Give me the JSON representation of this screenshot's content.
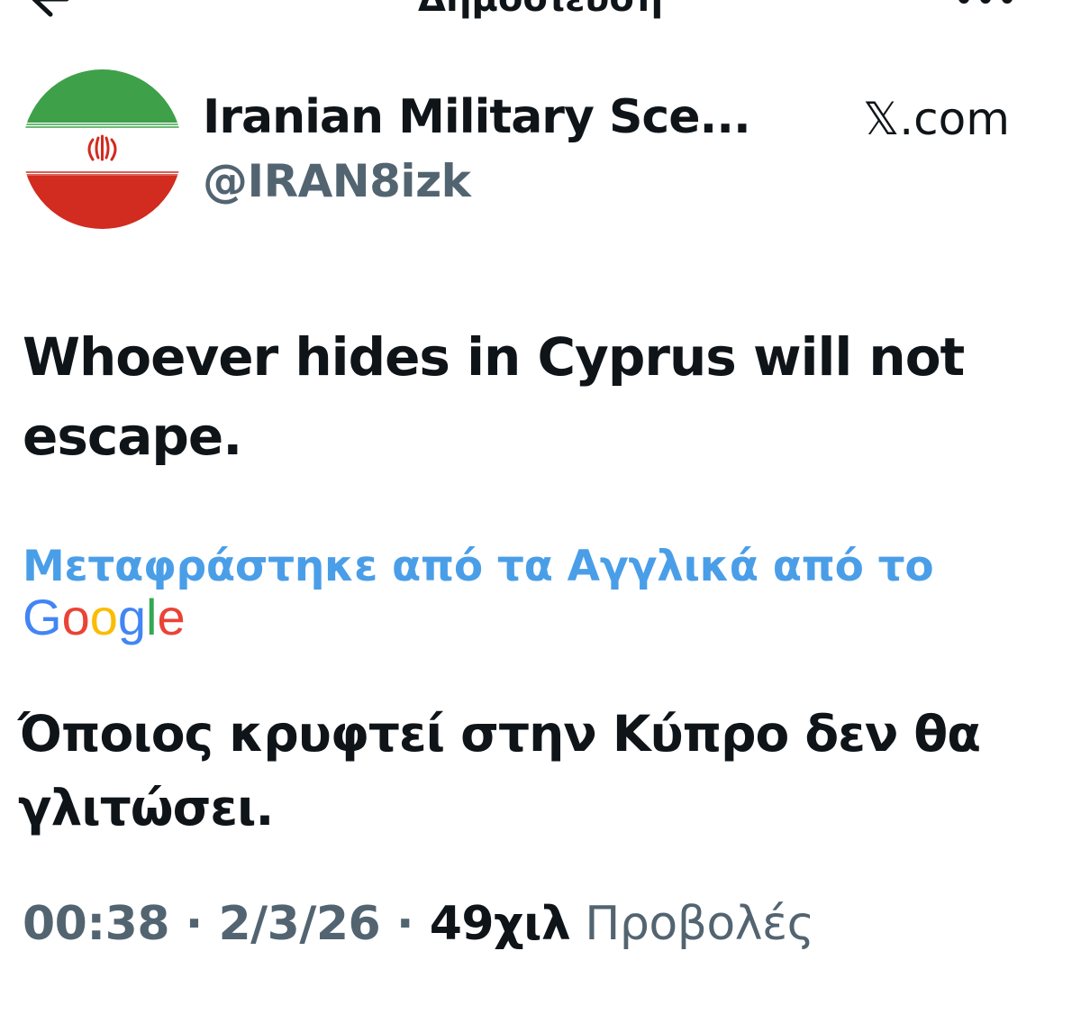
{
  "nav": {
    "title": "Δημοσίευση"
  },
  "author": {
    "display_name": "Iranian Military Sce...",
    "handle": "@IRAN8izk",
    "avatar_icon": "iran-flag-avatar",
    "source": "𝕏.com"
  },
  "post": {
    "text_line1": "Whoever hides in Cyprus will not",
    "text_line2": "escape.",
    "translated_by": "Μεταφράστηκε από τα Αγγλικά από το",
    "translator_logo": "Google",
    "translated_line1": "Όποιος κρυφτεί στην Κύπρο δεν θα",
    "translated_line2": "γλιτώσει."
  },
  "meta": {
    "time": "00:38",
    "sep1": " · ",
    "date": "2/3/26",
    "sep2": " · ",
    "views_count": "49χιλ",
    "views_label": " Προβολές"
  },
  "colors": {
    "text": "#0f1419",
    "secondary": "#536471",
    "link": "#4a9ee8",
    "google_blue": "#4285F4",
    "google_red": "#EA4335",
    "google_yellow": "#FBBC05",
    "google_green": "#34A853"
  }
}
